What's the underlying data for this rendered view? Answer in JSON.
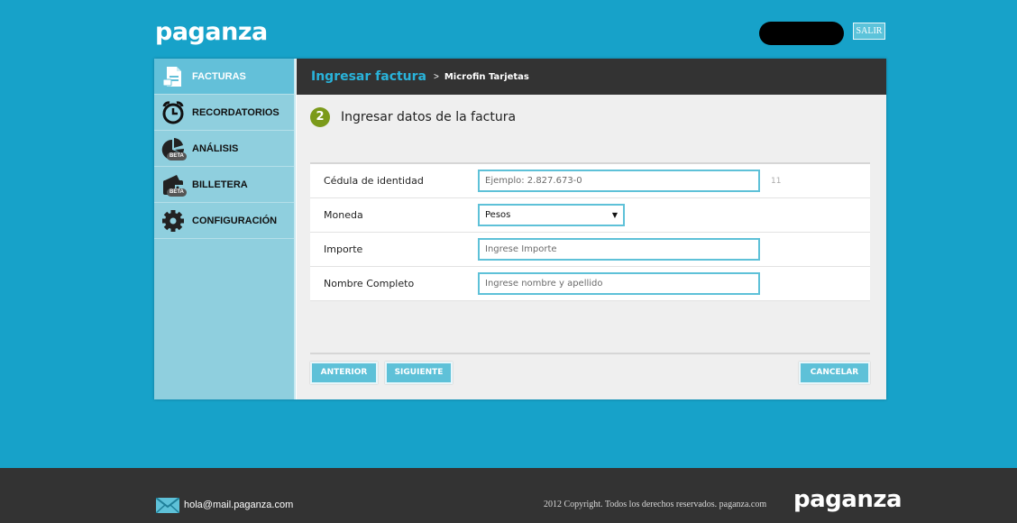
{
  "header": {
    "logo": "paganza",
    "logout_label": "SALIR"
  },
  "sidebar": {
    "items": [
      {
        "label": "FACTURAS",
        "icon": "document-icon",
        "active": true,
        "beta": false
      },
      {
        "label": "RECORDATORIOS",
        "icon": "alarm-clock-icon",
        "active": false,
        "beta": false
      },
      {
        "label": "ANÁLISIS",
        "icon": "pie-chart-icon",
        "active": false,
        "beta": true
      },
      {
        "label": "BILLETERA",
        "icon": "wallet-icon",
        "active": false,
        "beta": true
      },
      {
        "label": "CONFIGURACIÓN",
        "icon": "gear-icon",
        "active": false,
        "beta": false
      }
    ],
    "beta_label": "BETA"
  },
  "breadcrumb": {
    "main": "Ingresar factura",
    "separator": ">",
    "sub": "Microfin Tarjetas"
  },
  "step": {
    "number": "2",
    "title": "Ingresar datos de la factura"
  },
  "form": {
    "cedula": {
      "label": "Cédula de identidad",
      "placeholder": "Ejemplo: 2.827.673-0",
      "counter": "11"
    },
    "moneda": {
      "label": "Moneda",
      "value": "Pesos"
    },
    "importe": {
      "label": "Importe",
      "placeholder": "Ingrese Importe"
    },
    "nombre": {
      "label": "Nombre Completo",
      "placeholder": "Ingrese nombre y apellido"
    }
  },
  "actions": {
    "previous": "ANTERIOR",
    "next": "SIGUIENTE",
    "cancel": "CANCELAR"
  },
  "footer": {
    "email": "hola@mail.paganza.com",
    "copyright": "2012 Copyright. Todos los derechos reservados. paganza.com",
    "logo": "paganza"
  },
  "colors": {
    "background": "#17a2c9",
    "accent": "#5ec1d8",
    "sidebar": "#8fcfde",
    "header_dark": "#333333",
    "step_badge": "#7b9a1a"
  }
}
